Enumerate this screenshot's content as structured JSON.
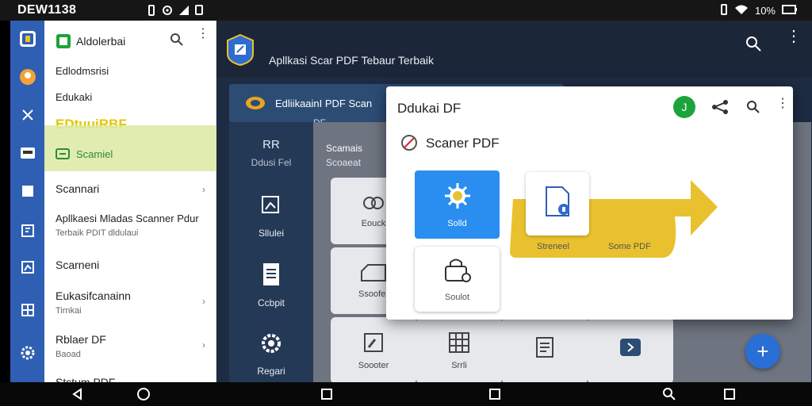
{
  "status_bar": {
    "time": "DEW1138",
    "battery": "10%",
    "icons_left": [
      "notification-icon",
      "wifi-calling-icon",
      "signal-icon",
      "sd-icon"
    ],
    "icons_right": [
      "vibrate-icon",
      "wifi-icon",
      "signal-icon",
      "battery-icon"
    ]
  },
  "nav_rail": {
    "items": [
      "app-logo-icon",
      "profile-icon",
      "tools-icon",
      "scan-icon",
      "page-icon",
      "document-icon",
      "chart-icon",
      "grid-icon",
      "settings-icon"
    ]
  },
  "drawer": {
    "title": "Aldolerbai",
    "items": [
      {
        "label": "Edlodmsrisi"
      },
      {
        "label": "Edukaki"
      },
      {
        "label": "EDtuuiRBF"
      },
      {
        "label": "Scamiel"
      },
      {
        "label": "Scannari"
      },
      {
        "label": "Apllkaesi Mladas Scanner Pdur",
        "sub": "Terbaik PDIT dldulaui"
      },
      {
        "label": "Scarneni"
      },
      {
        "label": "Eukasifcanainn",
        "sub": "Tirnkai"
      },
      {
        "label": "Rblaer DF",
        "sub": "Baoad"
      },
      {
        "label": "Ststum PDF"
      }
    ]
  },
  "main": {
    "title": "Apllkasi Scar PDF Tebaur Terbaik",
    "subbar_title": "EdliikaainI PDF Scan",
    "subbar_tab": "DF",
    "left_column": {
      "header": [
        "RR",
        "Ddusi Fel"
      ],
      "items": [
        "Sllulei",
        "Ccbpit",
        "Regari"
      ]
    },
    "grid_header": [
      "Scamais",
      "Scoaeat"
    ],
    "tiles": [
      "Eouck",
      "Ssoofer",
      "Soooter",
      "Srrli",
      "",
      ""
    ],
    "fab_label": "+"
  },
  "dialog": {
    "title": "Ddukai DF",
    "avatar_letter": "J",
    "subtitle": "Scaner PDF",
    "card_selected": "Solld",
    "card_second": "Soulot",
    "banner_left": "Streneel",
    "banner_right": "Some PDF",
    "colors": {
      "accent": "#2a8ef0",
      "banner": "#e9c12e",
      "avatar": "#1ba43a"
    }
  },
  "nav_bar": {
    "buttons": [
      "back-icon",
      "home-icon",
      "recents-icon",
      "square-icon",
      "search-icon",
      "square-icon"
    ]
  }
}
